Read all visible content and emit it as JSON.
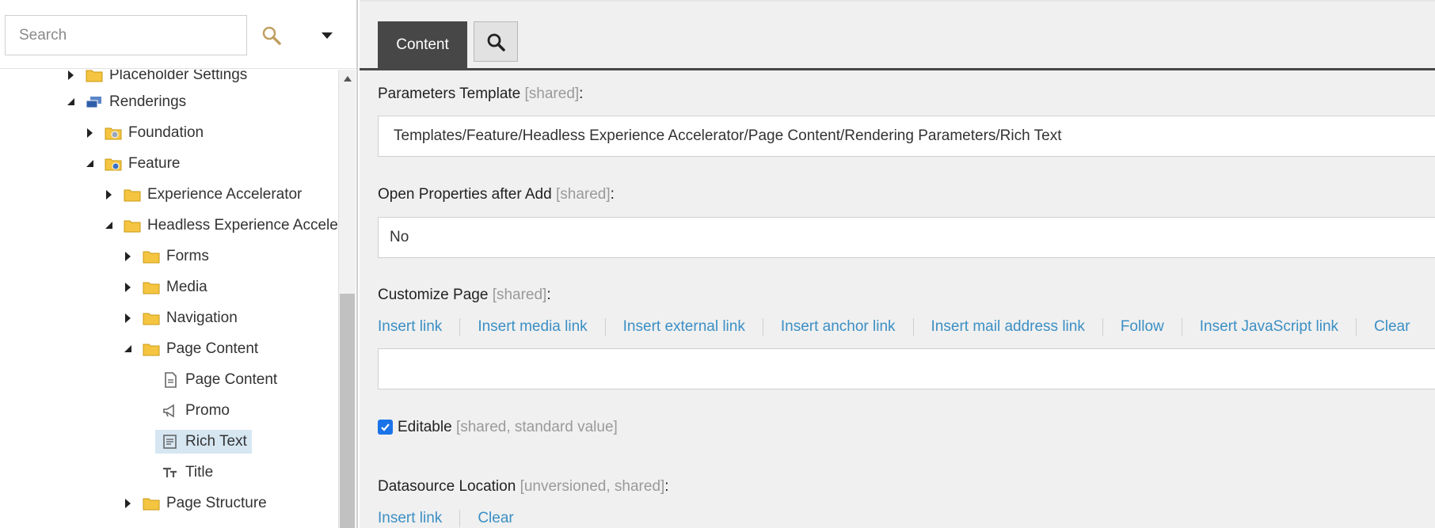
{
  "search": {
    "placeholder": "Search"
  },
  "tree": {
    "items": [
      {
        "label": "Placeholder Settings"
      },
      {
        "label": "Renderings"
      },
      {
        "label": "Foundation"
      },
      {
        "label": "Feature"
      },
      {
        "label": "Experience Accelerator"
      },
      {
        "label": "Headless Experience Acceler"
      },
      {
        "label": "Forms"
      },
      {
        "label": "Media"
      },
      {
        "label": "Navigation"
      },
      {
        "label": "Page Content"
      },
      {
        "label": "Page Content"
      },
      {
        "label": "Promo"
      },
      {
        "label": "Rich Text"
      },
      {
        "label": "Title"
      },
      {
        "label": "Page Structure"
      }
    ]
  },
  "editor": {
    "tabs": {
      "content": "Content"
    },
    "fields": {
      "parameters_template": {
        "label": "Parameters Template",
        "meta": "[shared]",
        "value": "Templates/Feature/Headless Experience Accelerator/Page Content/Rendering Parameters/Rich Text"
      },
      "open_properties": {
        "label": "Open Properties after Add",
        "meta": "[shared]",
        "value": "No"
      },
      "customize_page": {
        "label": "Customize Page",
        "meta": "[shared]",
        "links": [
          "Insert link",
          "Insert media link",
          "Insert external link",
          "Insert anchor link",
          "Insert mail address link",
          "Follow",
          "Insert JavaScript link",
          "Clear"
        ],
        "value": ""
      },
      "editable": {
        "label": "Editable",
        "meta": "[shared, standard value]",
        "checked": true
      },
      "datasource_location": {
        "label": "Datasource Location",
        "meta": "[unversioned, shared]",
        "links": [
          "Insert link",
          "Clear"
        ]
      }
    }
  },
  "colors": {
    "accent_link": "#3b8fc4",
    "tab_active": "#474747",
    "selection": "#d6e7f2"
  }
}
